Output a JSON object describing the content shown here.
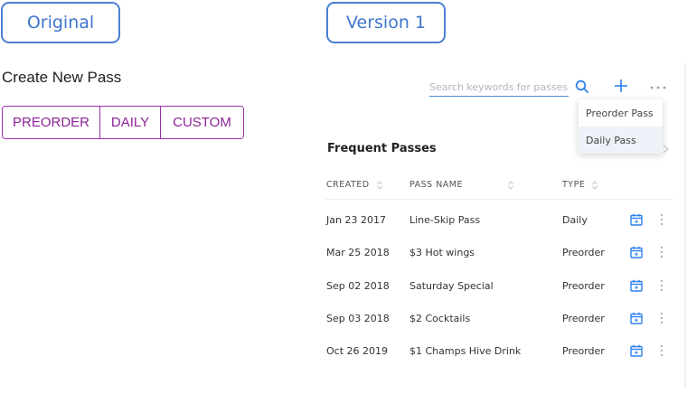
{
  "labels": {
    "original": "Original",
    "version": "Version 1"
  },
  "original": {
    "title": "Create New Pass",
    "buttons": [
      "PREORDER",
      "DAILY",
      "CUSTOM"
    ]
  },
  "version": {
    "search": {
      "placeholder": "Search keywords for passes",
      "value": ""
    },
    "dropdown": {
      "items": [
        "Preorder Pass",
        "Daily Pass"
      ],
      "active_index": 1
    },
    "section_title": "Frequent Passes",
    "columns": [
      "CREATED",
      "PASS NAME",
      "TYPE"
    ],
    "rows": [
      {
        "created": "Jan 23 2017",
        "name": " Line-Skip Pass",
        "type": "Daily"
      },
      {
        "created": "Mar 25 2018",
        "name": "$3 Hot wings",
        "type": "Preorder"
      },
      {
        "created": "Sep 02 2018",
        "name": " Saturday Special",
        "type": "Preorder"
      },
      {
        "created": "Sep 03 2018",
        "name": "$2 Cocktails",
        "type": "Preorder"
      },
      {
        "created": "Oct 26 2019",
        "name": "$1 Champs Hive Drink",
        "type": "Preorder"
      }
    ],
    "icons": {
      "search": "search-icon",
      "add": "plus-icon",
      "more": "more-horizontal-icon",
      "row_calendar": "calendar-icon",
      "row_menu": "more-vertical-icon"
    }
  },
  "colors": {
    "tag_blue": "#3f76cc",
    "accent_purple": "#8d2398",
    "action_blue": "#2f80ed"
  }
}
